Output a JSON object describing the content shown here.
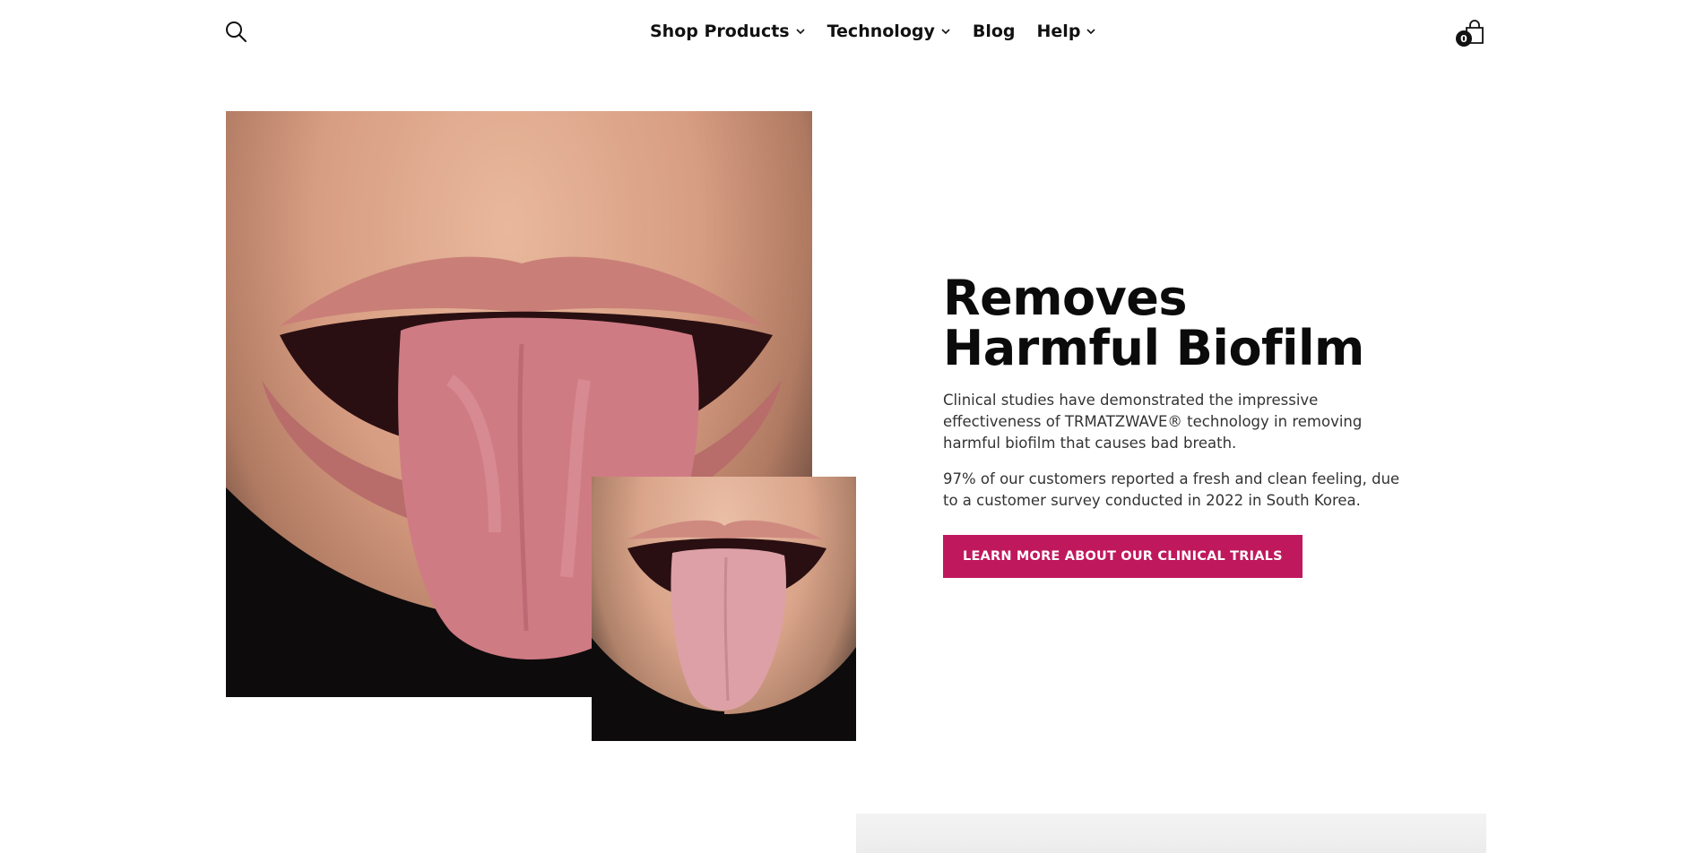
{
  "header": {
    "search_icon": "search-icon",
    "nav": [
      {
        "label": "Shop Products",
        "has_dropdown": true
      },
      {
        "label": "Technology",
        "has_dropdown": true
      },
      {
        "label": "Blog",
        "has_dropdown": false
      },
      {
        "label": "Help",
        "has_dropdown": true
      }
    ],
    "cart_icon": "shopping-bag-icon",
    "cart_count": "0"
  },
  "hero": {
    "title": "Removes Harmful Biofilm",
    "paragraph_1": "Clinical studies have demonstrated the impressive effectiveness of TRMATZWAVE® technology in removing harmful biofilm that causes bad breath.",
    "paragraph_2": "97% of our customers reported a fresh and clean feeling, due to a customer survey conducted in 2022 in South Korea.",
    "cta_label": "LEARN MORE ABOUT OUR CLINICAL TRIALS",
    "accent_color": "#c0185d"
  }
}
